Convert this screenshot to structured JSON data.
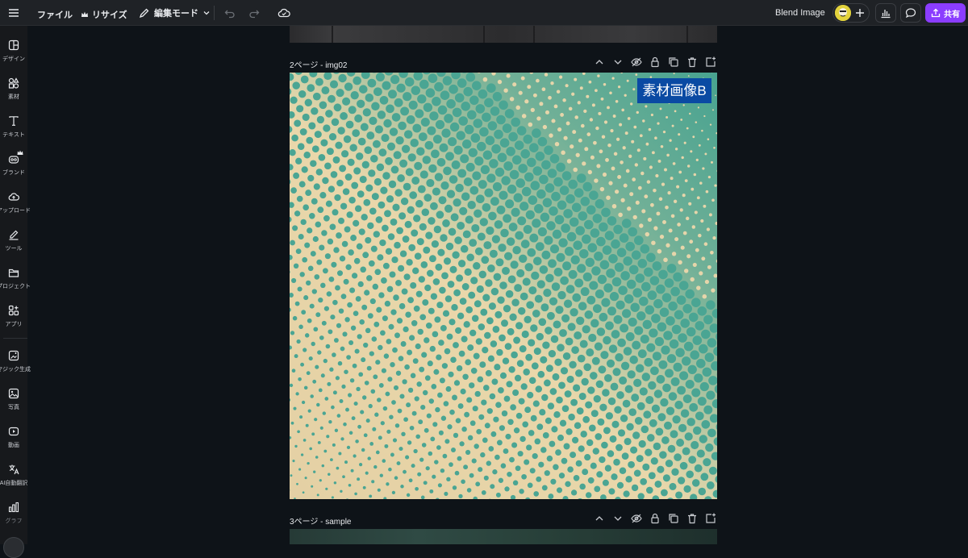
{
  "topbar": {
    "file_label": "ファイル",
    "resize_label": "リサイズ",
    "edit_mode_label": "編集モード",
    "doc_title": "Blend Image",
    "share_label": "共有"
  },
  "sidebar": {
    "items": [
      {
        "label": "デザイン",
        "icon": "layout-icon"
      },
      {
        "label": "素材",
        "icon": "elements-icon"
      },
      {
        "label": "テキスト",
        "icon": "text-icon"
      },
      {
        "label": "ブランド",
        "icon": "brand-icon"
      },
      {
        "label": "アップロード",
        "icon": "upload-cloud-icon"
      },
      {
        "label": "ツール",
        "icon": "pen-tool-icon"
      },
      {
        "label": "プロジェクト",
        "icon": "folder-icon"
      },
      {
        "label": "アプリ",
        "icon": "apps-icon"
      },
      {
        "label": "マジック生成",
        "icon": "magic-image-icon"
      },
      {
        "label": "写真",
        "icon": "photo-icon"
      },
      {
        "label": "動画",
        "icon": "video-icon"
      },
      {
        "label": "AI自動翻訳",
        "icon": "translate-icon"
      },
      {
        "label": "グラフ",
        "icon": "chart-icon"
      }
    ]
  },
  "canvas": {
    "page2_label": "2ページ - img02",
    "page3_label": "3ページ - sample",
    "image_overlay_label": "素材画像B"
  },
  "colors": {
    "accent": "#8b3dff",
    "label_bg": "#0a4aa3",
    "halftone_dot": "#4aa593",
    "paper": "#e9d6a9"
  }
}
